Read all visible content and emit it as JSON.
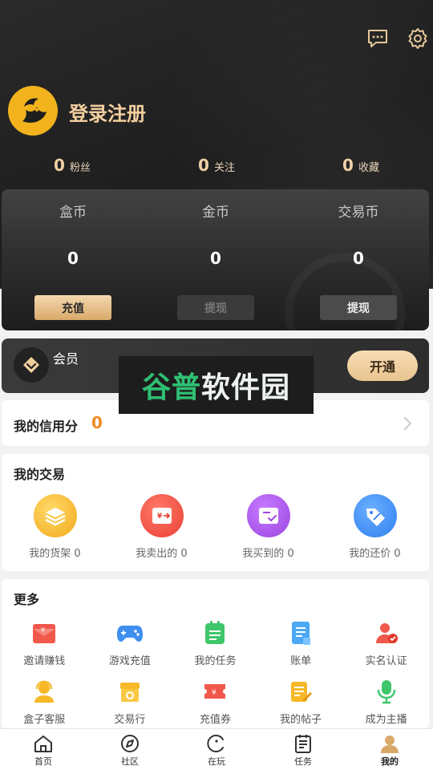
{
  "header": {
    "login_label": "登录注册",
    "stats": [
      {
        "value": "0",
        "label": "粉丝"
      },
      {
        "value": "0",
        "label": "关注"
      },
      {
        "value": "0",
        "label": "收藏"
      }
    ]
  },
  "wallet": {
    "columns": [
      {
        "title": "盒币",
        "value": "0",
        "button": "充值"
      },
      {
        "title": "金币",
        "value": "0",
        "button": "提现"
      },
      {
        "title": "交易币",
        "value": "0",
        "button": "提现"
      }
    ]
  },
  "member": {
    "label": "会员",
    "button": "开通"
  },
  "watermark": {
    "part1": "谷普",
    "part2": "软件园"
  },
  "credit": {
    "label": "我的信用分",
    "value": "0"
  },
  "trade": {
    "title": "我的交易",
    "items": [
      {
        "label": "我的货架 0",
        "icon": "layers-icon",
        "color": "#f7b928"
      },
      {
        "label": "我卖出的 0",
        "icon": "sold-icon",
        "color": "#f0584b"
      },
      {
        "label": "我买到的 0",
        "icon": "bought-icon",
        "color": "#a958e8"
      },
      {
        "label": "我的还价 0",
        "icon": "price-tag-icon",
        "color": "#3d8ff3"
      }
    ]
  },
  "more": {
    "title": "更多",
    "items": [
      {
        "label": "邀请赚钱",
        "icon": "invite-envelope-icon"
      },
      {
        "label": "游戏充值",
        "icon": "gamepad-icon"
      },
      {
        "label": "我的任务",
        "icon": "task-clipboard-icon"
      },
      {
        "label": "账单",
        "icon": "bill-icon"
      },
      {
        "label": "实名认证",
        "icon": "verify-user-icon"
      },
      {
        "label": "盒子客服",
        "icon": "customer-service-icon"
      },
      {
        "label": "交易行",
        "icon": "shop-icon"
      },
      {
        "label": "充值券",
        "icon": "coupon-icon"
      },
      {
        "label": "我的帖子",
        "icon": "post-edit-icon"
      },
      {
        "label": "成为主播",
        "icon": "microphone-icon"
      }
    ]
  },
  "tabbar": {
    "tabs": [
      {
        "label": "首页",
        "icon": "home-icon"
      },
      {
        "label": "社区",
        "icon": "compass-icon"
      },
      {
        "label": "在玩",
        "icon": "playing-icon"
      },
      {
        "label": "任务",
        "icon": "task-list-icon"
      },
      {
        "label": "我的",
        "icon": "profile-icon",
        "active": true
      }
    ]
  },
  "colors": {
    "accent_gold": "#f3cf9f",
    "credit_orange": "#f28a23",
    "header_dark": "#222222"
  }
}
